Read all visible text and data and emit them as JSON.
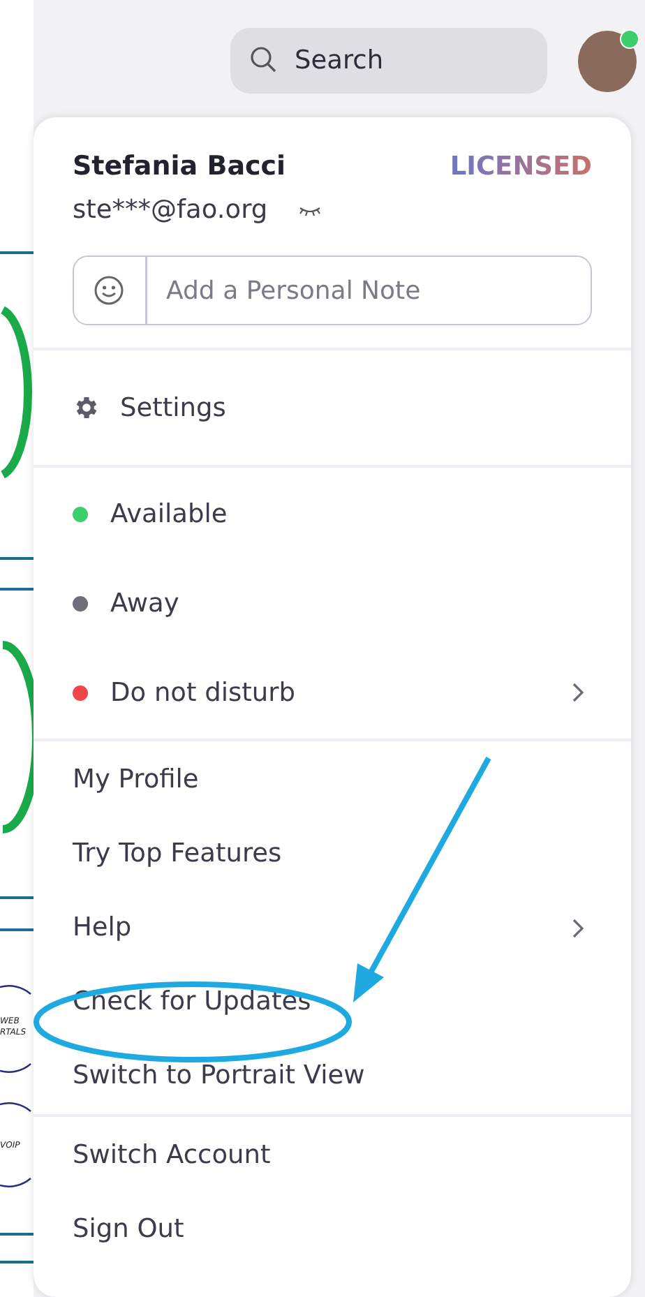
{
  "background": {
    "labels": [
      "WEB",
      "RTALS",
      "VOIP"
    ]
  },
  "topbar": {
    "search": {
      "placeholder": "Search"
    },
    "avatar": {
      "online": true
    }
  },
  "profile": {
    "name": "Stefania Bacci",
    "badge": "LICENSED",
    "email": "ste***@fao.org",
    "note": {
      "placeholder": "Add a Personal Note"
    }
  },
  "menu_sections": [
    {
      "items": [
        {
          "kind": "settings",
          "label": "Settings",
          "submenu": false
        }
      ]
    },
    {
      "items": [
        {
          "kind": "status",
          "label": "Available",
          "color": "#3ccf6b",
          "submenu": false
        },
        {
          "kind": "status",
          "label": "Away",
          "color": "#6e6e7a",
          "submenu": false
        },
        {
          "kind": "status",
          "label": "Do not disturb",
          "color": "#f0464a",
          "submenu": true
        }
      ]
    },
    {
      "items": [
        {
          "kind": "plain",
          "label": "My Profile",
          "submenu": false
        },
        {
          "kind": "plain",
          "label": "Try Top Features",
          "submenu": false
        },
        {
          "kind": "plain",
          "label": "Help",
          "submenu": true
        },
        {
          "kind": "plain",
          "label": "Check for Updates",
          "submenu": false
        },
        {
          "kind": "plain",
          "label": "Switch to Portrait View",
          "submenu": false
        }
      ]
    },
    {
      "items": [
        {
          "kind": "plain",
          "label": "Switch Account",
          "submenu": false
        },
        {
          "kind": "plain",
          "label": "Sign Out",
          "submenu": false
        }
      ]
    }
  ]
}
